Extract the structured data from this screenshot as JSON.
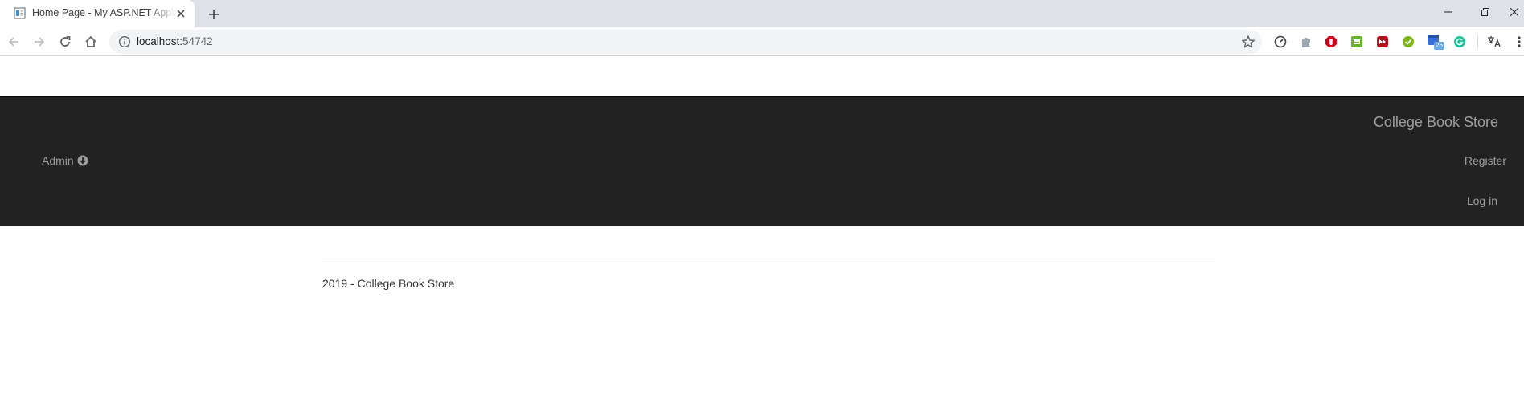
{
  "browser": {
    "tab_title": "Home Page - My ASP.NET Application",
    "new_tab_icon": "plus-icon",
    "url_host": "localhost:",
    "url_port": "54742",
    "window_controls": [
      "minimize-icon",
      "restore-icon",
      "close-icon"
    ],
    "extensions": [
      "speedometer-icon",
      "puzzle-icon",
      "adblock-icon",
      "print-icon",
      "video-forward-icon",
      "checkmark-icon",
      "calendar-icon",
      "grammarly-icon",
      "translate-icon",
      "menu-icon"
    ],
    "calendar_badge": "26"
  },
  "site": {
    "brand": "College Book Store",
    "admin_label": "Admin",
    "register_label": "Register",
    "login_label": "Log in",
    "footer": "2019 - College Book Store"
  },
  "colors": {
    "navbar_bg": "#222222",
    "nav_text": "#9d9d9d",
    "chrome_frame": "#dee1e6"
  }
}
